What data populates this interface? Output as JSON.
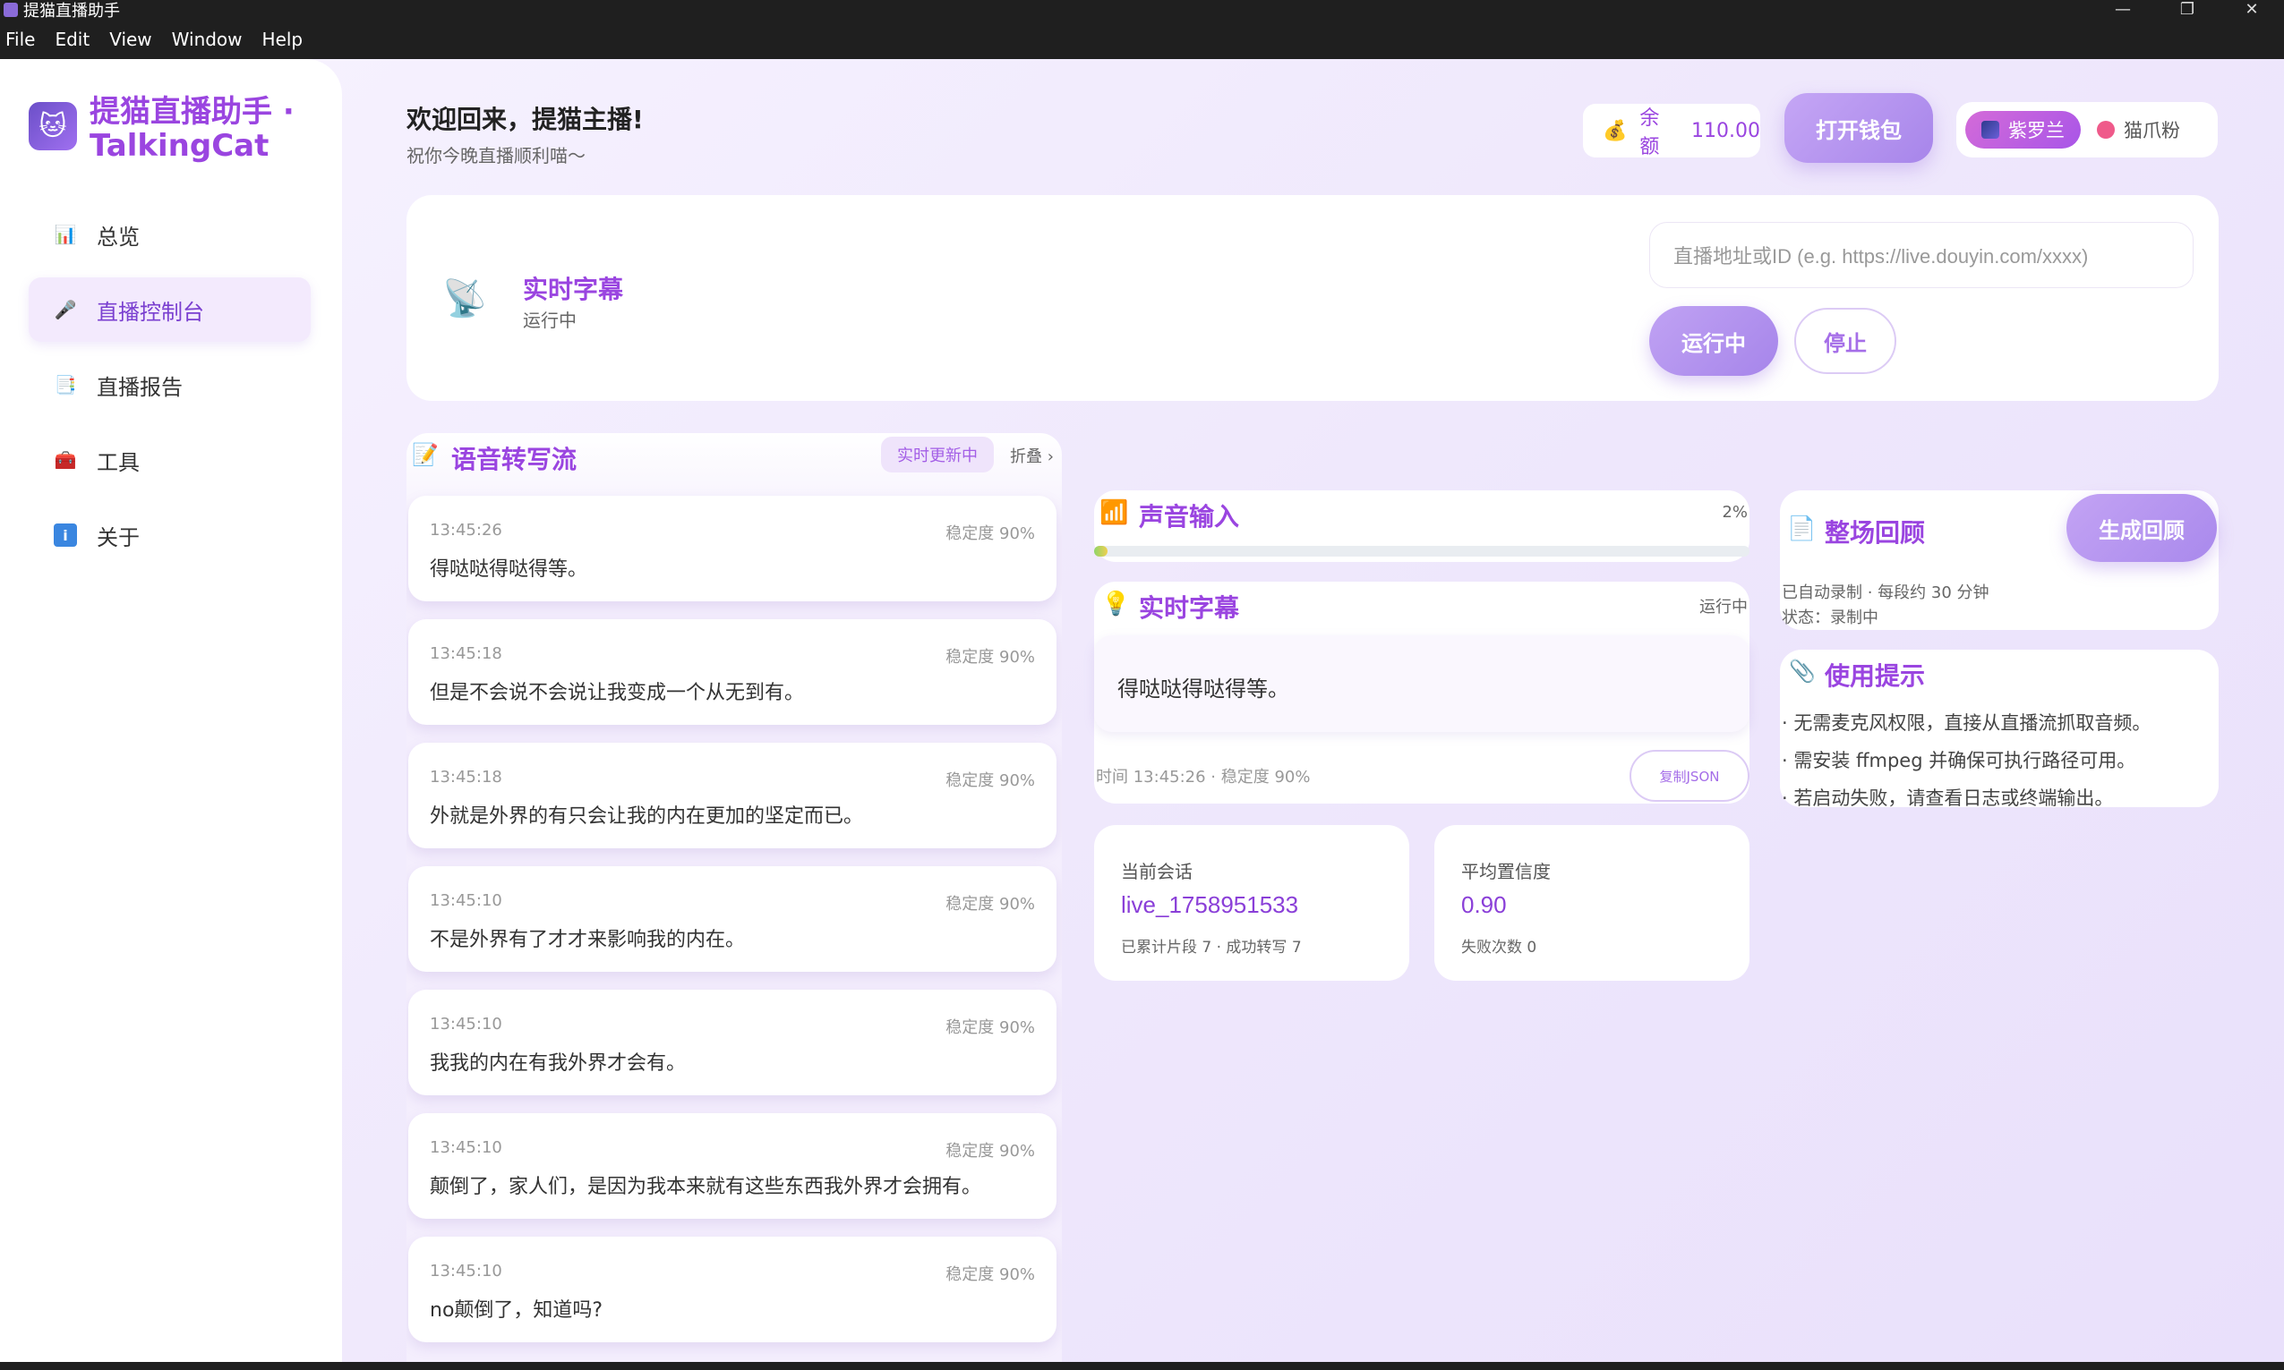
{
  "window": {
    "title": "提猫直播助手",
    "controls": [
      "—",
      "❐",
      "✕"
    ]
  },
  "menu": [
    "File",
    "Edit",
    "View",
    "Window",
    "Help"
  ],
  "brand": {
    "name": "提猫直播助手 · TalkingCat"
  },
  "nav": [
    {
      "label": "总览",
      "icon": "chart-icon"
    },
    {
      "label": "直播控制台",
      "icon": "microphone-icon"
    },
    {
      "label": "直播报告",
      "icon": "report-icon"
    },
    {
      "label": "工具",
      "icon": "toolbox-icon"
    },
    {
      "label": "关于",
      "icon": "info-icon"
    }
  ],
  "header": {
    "welcome": "欢迎回来，提猫主播!",
    "subtitle": "祝你今晚直播顺利喵～",
    "balance_label": "余额",
    "balance_value": "110.00",
    "wallet_button": "打开钱包",
    "themes": [
      "紫罗兰",
      "猫爪粉"
    ]
  },
  "top_panel": {
    "title": "实时字幕",
    "status": "运行中",
    "url_placeholder": "直播地址或ID (e.g. https://live.douyin.com/xxxx)",
    "run_button": "运行中",
    "stop_button": "停止"
  },
  "stream": {
    "title": "语音转写流",
    "badge": "实时更新中",
    "fold": "折叠 ›",
    "entries": [
      {
        "time": "13:45:26",
        "stability": "稳定度 90%",
        "text": "得哒哒得哒得等。"
      },
      {
        "time": "13:45:18",
        "stability": "稳定度 90%",
        "text": "但是不会说不会说让我变成一个从无到有。"
      },
      {
        "time": "13:45:18",
        "stability": "稳定度 90%",
        "text": "外就是外界的有只会让我的内在更加的坚定而已。"
      },
      {
        "time": "13:45:10",
        "stability": "稳定度 90%",
        "text": "不是外界有了才才来影响我的内在。"
      },
      {
        "time": "13:45:10",
        "stability": "稳定度 90%",
        "text": "我我的内在有我外界才会有。"
      },
      {
        "time": "13:45:10",
        "stability": "稳定度 90%",
        "text": "颠倒了，家人们，是因为我本来就有这些东西我外界才会拥有。"
      },
      {
        "time": "13:45:10",
        "stability": "稳定度 90%",
        "text": "no颠倒了，知道吗?"
      }
    ]
  },
  "voice": {
    "title": "声音输入",
    "level_percent": 2,
    "level_label": "2%"
  },
  "subtitle_card": {
    "title": "实时字幕",
    "status": "运行中",
    "text": "得哒哒得哒得等。",
    "meta": "时间 13:45:26 · 稳定度 90%",
    "copy_button": "复制JSON"
  },
  "stats": {
    "session": {
      "label": "当前会话",
      "value": "live_1758951533",
      "sub": "已累计片段 7 · 成功转写 7"
    },
    "confidence": {
      "label": "平均置信度",
      "value": "0.90",
      "sub": "失败次数 0"
    }
  },
  "review": {
    "title": "整场回顾",
    "button": "生成回顾",
    "line1": "已自动录制 · 每段约 30 分钟",
    "line2": "状态：录制中"
  },
  "tips": {
    "title": "使用提示",
    "items": [
      "· 无需麦克风权限，直接从直播流抓取音频。",
      "· 需安装 ffmpeg 并确保可执行路径可用。",
      "· 若启动失败，请查看日志或终端输出。"
    ]
  }
}
